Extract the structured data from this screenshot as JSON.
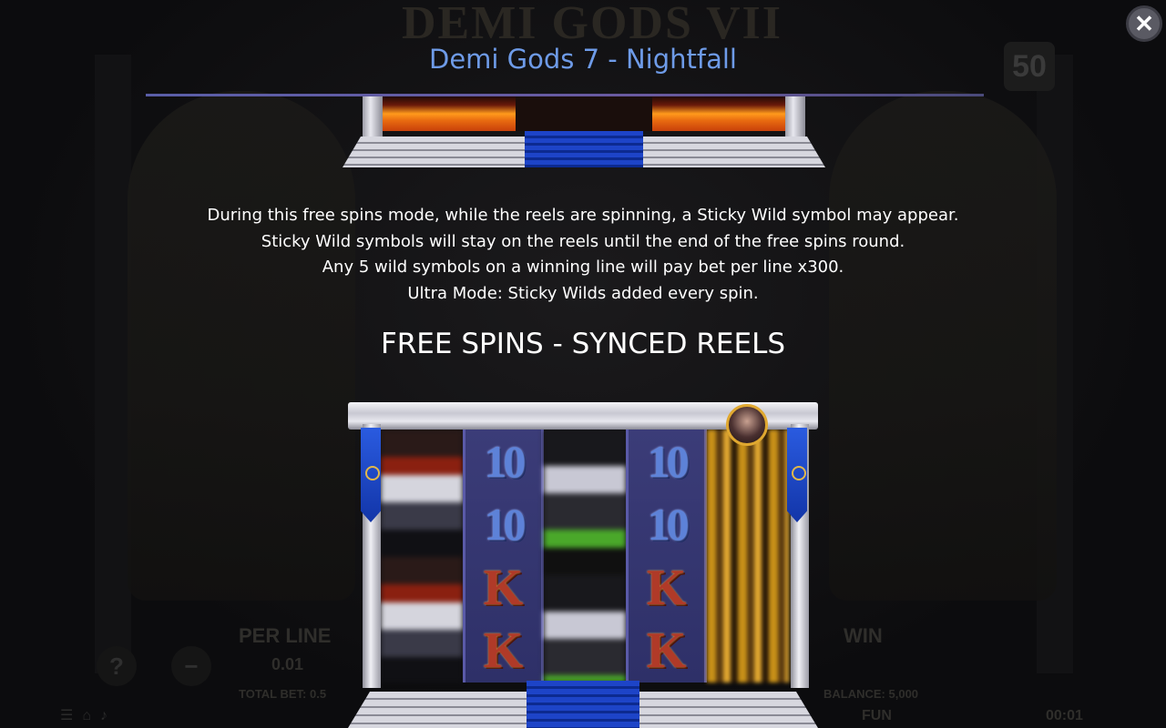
{
  "background": {
    "logo_text": "DEMI GODS VII",
    "lines_badge": "50",
    "hud": {
      "per_line_label": "PER LINE",
      "per_line_value": "0.01",
      "total_bet": "TOTAL BET: 0.5",
      "win_label": "WIN",
      "balance": "BALANCE: 5,000",
      "mode": "FUN",
      "time": "00:01",
      "help_symbol": "?",
      "minus_symbol": "−"
    }
  },
  "modal": {
    "title": "Demi Gods 7 - Nightfall",
    "close_symbol": "✕",
    "description": [
      "During this free spins mode, while the reels are spinning, a Sticky Wild symbol may appear.",
      "Sticky Wild symbols will stay on the reels until the end of the free spins round.",
      "Any 5 wild symbols on a winning line will pay bet per line x300.",
      "Ultra Mode: Sticky Wilds added every spin."
    ],
    "section_title": "FREE SPINS - SYNCED REELS",
    "synced_reel_symbols": [
      "10",
      "10",
      "K",
      "K"
    ]
  },
  "colors": {
    "title": "#6e9be8",
    "accent_line": "#5a5ea8"
  }
}
